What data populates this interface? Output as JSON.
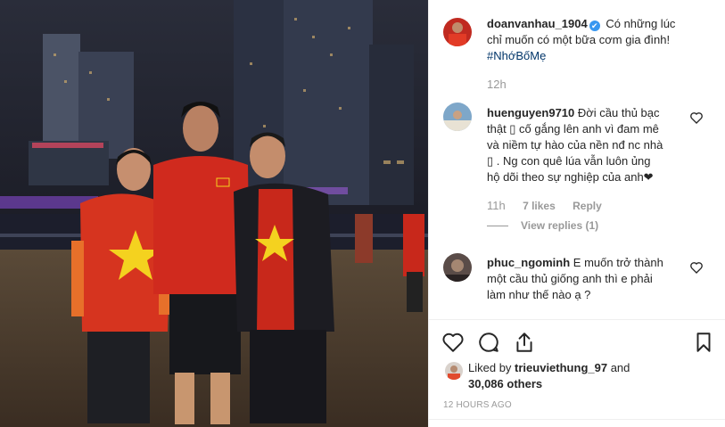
{
  "post": {
    "author": "doanvanhau_1904",
    "verified_mark": "✔",
    "caption_line1": "Có những lúc",
    "caption_line2": "chỉ muốn có một bữa cơm gia đình!",
    "hashtag": "#NhớBốMẹ",
    "time": "12h"
  },
  "comments": [
    {
      "user": "huenguyen9710",
      "line1": "Đời cầu thủ bạc",
      "line2": "thật ▯ cố gắng lên anh vì đam mê",
      "line3": "và niềm tự hào của nền nđ nc nhà",
      "line4": "▯ . Ng con quê lúa vẫn luôn ủng",
      "line5": "hộ dõi theo sự nghiệp của anh❤",
      "time": "11h",
      "likes": "7 likes",
      "reply": "Reply",
      "view_replies": "View replies (1)"
    },
    {
      "user": "phuc_ngominh",
      "line1": "E muốn trở thành",
      "line2": "một cầu thủ giống anh thì e phải",
      "line3": "làm như thế nào ạ ?"
    }
  ],
  "likes": {
    "prefix": "Liked by",
    "user": "trieuviethung_97",
    "and": "and",
    "count": "30,086 others"
  },
  "timestamp": "12 HOURS AGO",
  "icons": [
    "heart-icon",
    "comment-icon",
    "share-icon",
    "bookmark-icon"
  ],
  "colors": {
    "link": "#003569",
    "verified": "#3897f0",
    "muted": "#999999"
  }
}
